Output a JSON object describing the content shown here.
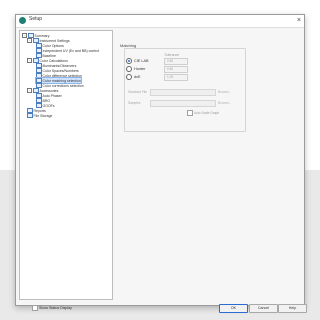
{
  "window": {
    "title": "Setup",
    "close_glyph": "×"
  },
  "tree": {
    "items": [
      {
        "label": "Summary",
        "expander": "-"
      },
      {
        "label": "Instrument Settings",
        "expander": "-"
      },
      {
        "label": "Color Options"
      },
      {
        "label": "Independent UV (Ex and BB) control"
      },
      {
        "label": "Baseline"
      },
      {
        "label": "Color Calculations",
        "expander": "-"
      },
      {
        "label": "Illuminants/Observers"
      },
      {
        "label": "Color Spaces/Numbers"
      },
      {
        "label": "Color difference selection"
      },
      {
        "label": "Color matching selection"
      },
      {
        "label": "Color corrections selection"
      },
      {
        "label": "Accessories",
        "expander": "-"
      },
      {
        "label": "Auto Phaser"
      },
      {
        "label": "BRO"
      },
      {
        "label": "GOOFs"
      },
      {
        "label": "Reports"
      },
      {
        "label": "File Storage"
      }
    ]
  },
  "matching": {
    "group_title": "Matching",
    "tolerance_header": "Tolerance",
    "options": [
      {
        "label": "CIE LAB",
        "value": "0.50",
        "checked": true
      },
      {
        "label": "Hunter",
        "value": "0.50",
        "checked": false
      },
      {
        "label": "dxE",
        "value": "1.00",
        "checked": false
      }
    ],
    "standard_file_label": "Standard File",
    "samples_label": "Samples",
    "browse_label": "Browse...",
    "auto_scale_label": "Auto Scale Graph"
  },
  "bottom": {
    "show_status_label": "Show Status Display",
    "ok_label": "OK",
    "cancel_label": "Cancel",
    "help_label": "Help"
  }
}
